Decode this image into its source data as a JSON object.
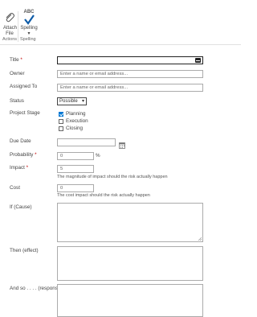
{
  "ribbon": {
    "attach_label": "Attach File",
    "spelling_abc": "ABC",
    "spelling_label": "Spelling",
    "spelling_dropdown": "▾",
    "group_actions": "Actions",
    "group_spelling": "Spelling"
  },
  "form": {
    "title_label": "Title",
    "required_mark": "*",
    "owner_label": "Owner",
    "owner_placeholder": "Enter a name or email address...",
    "assigned_label": "Assigned To",
    "assigned_placeholder": "Enter a name or email address...",
    "status_label": "Status",
    "status_value": "Possible",
    "stage_label": "Project Stage",
    "stage_options": [
      {
        "label": "Planning",
        "checked": true
      },
      {
        "label": "Execution",
        "checked": false
      },
      {
        "label": "Closing",
        "checked": false
      }
    ],
    "due_label": "Due Date",
    "probability_label": "Probability",
    "probability_value": "0",
    "probability_suffix": "%",
    "impact_label": "Impact",
    "impact_value": "5",
    "impact_hint": "The magnitude of impact should the risk actually happen",
    "cost_label": "Cost",
    "cost_value": "0",
    "cost_hint": "The cost impact should the risk actually happen",
    "if_label": "If (Cause)",
    "then_label": "Then (effect)",
    "andso_label": "And so . . . . (response)"
  },
  "colors": {
    "accent": "#0078d4",
    "required": "#bf0000"
  }
}
